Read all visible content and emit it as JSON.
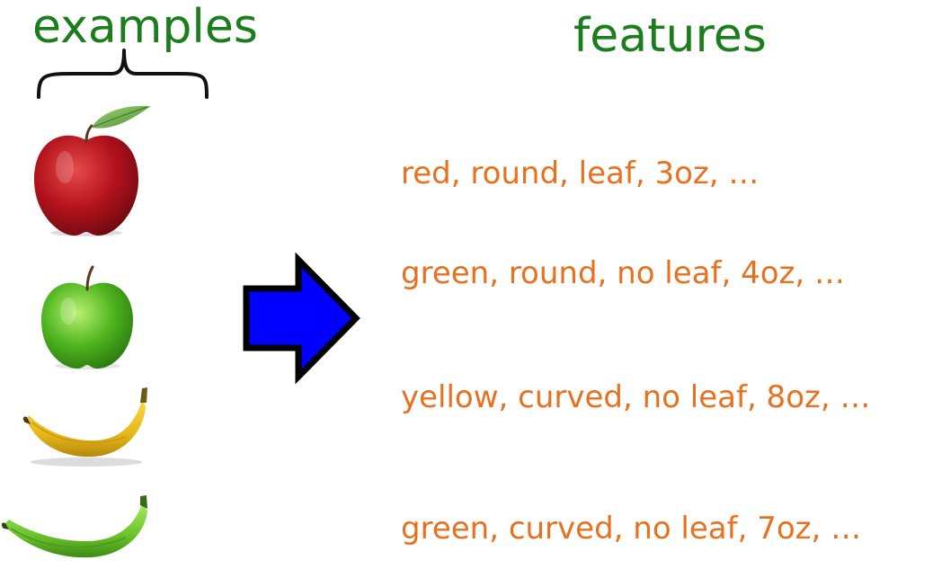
{
  "headings": {
    "examples": "examples",
    "features": "features"
  },
  "examples": [
    {
      "fruit": "red-apple-icon",
      "features": "red, round, leaf, 3oz, …"
    },
    {
      "fruit": "green-apple-icon",
      "features": "green, round, no leaf, 4oz, …"
    },
    {
      "fruit": "yellow-banana-icon",
      "features": "yellow, curved, no leaf, 8oz, …"
    },
    {
      "fruit": "green-banana-icon",
      "features": "green, curved, no leaf, 7oz, …"
    }
  ],
  "colors": {
    "heading": "#1b7d1b",
    "features_text": "#e8701f",
    "arrow_fill": "#0000ff",
    "arrow_stroke": "#000000"
  }
}
